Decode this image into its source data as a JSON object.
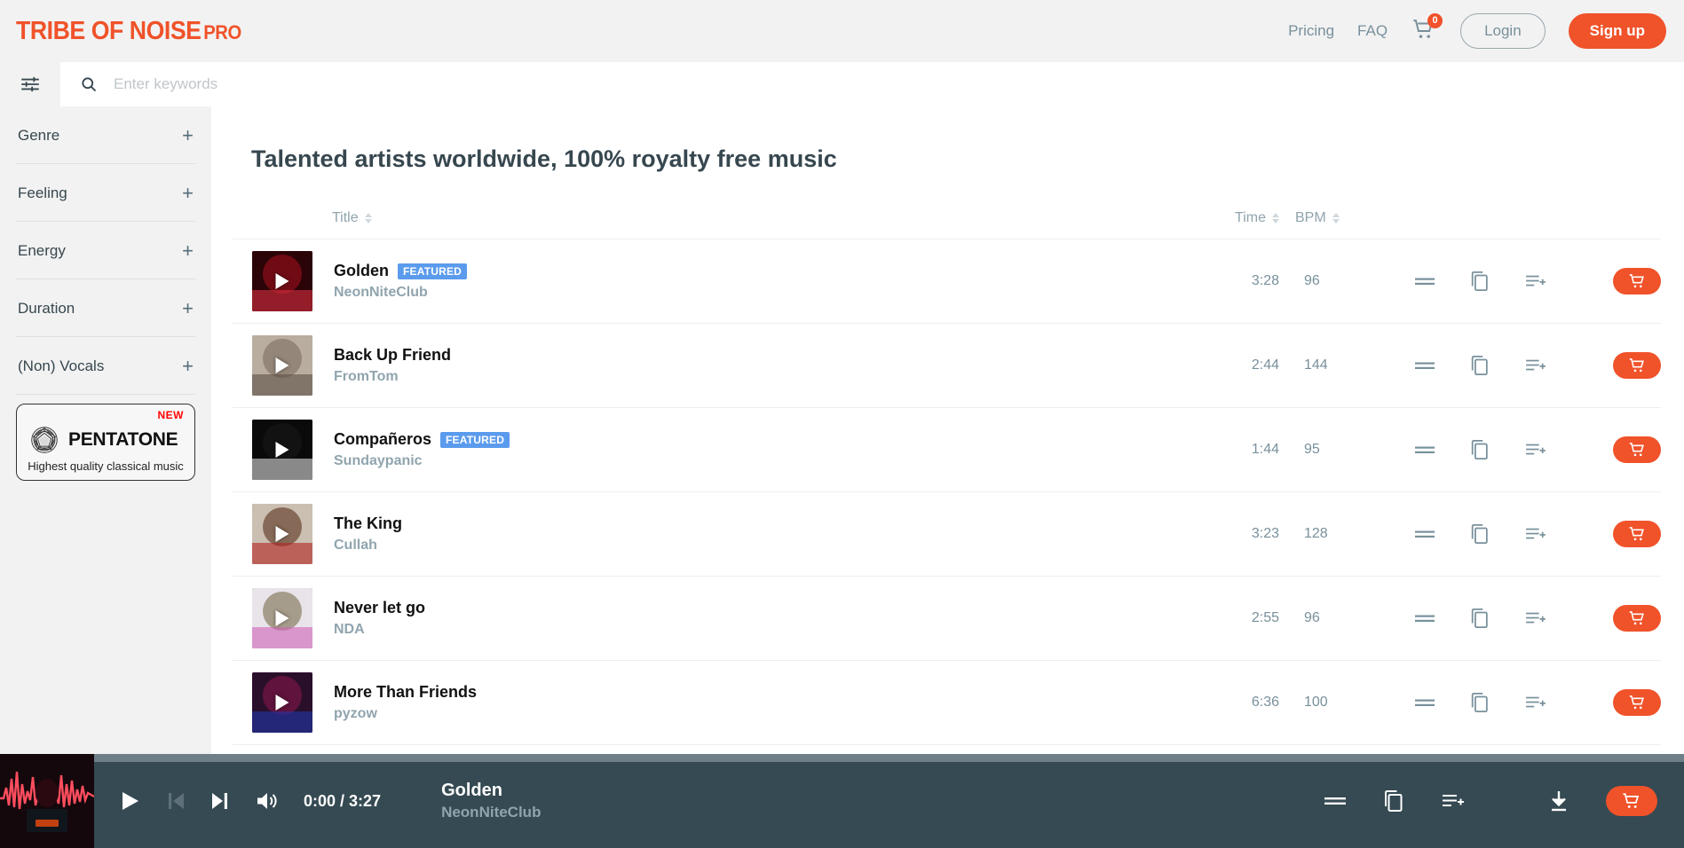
{
  "header": {
    "logo_main": "TRIBE OF NOISE",
    "logo_pro": "PRO",
    "nav": [
      {
        "label": "Pricing"
      },
      {
        "label": "FAQ"
      }
    ],
    "cart_count": "0",
    "login_label": "Login",
    "signup_label": "Sign up",
    "accent_color": "#f0522a"
  },
  "search": {
    "placeholder": "Enter keywords",
    "value": ""
  },
  "sidebar": {
    "filters": [
      {
        "label": "Genre",
        "expander": "+"
      },
      {
        "label": "Feeling",
        "expander": "+"
      },
      {
        "label": "Energy",
        "expander": "+"
      },
      {
        "label": "Duration",
        "expander": "+"
      },
      {
        "label": "(Non) Vocals",
        "expander": "+"
      }
    ],
    "promo": {
      "new_label": "NEW",
      "brand": "PENTATONE",
      "tagline": "Highest quality classical music"
    }
  },
  "main": {
    "page_title": "Talented artists worldwide, 100% royalty free music",
    "columns": {
      "title": "Title",
      "time": "Time",
      "bpm": "BPM"
    },
    "tracks": [
      {
        "title": "Golden",
        "artist": "NeonNiteClub",
        "badge": "FEATURED",
        "time": "3:28",
        "bpm": "96",
        "thumb_colors": [
          "#2b0408",
          "#7d0d16",
          "#d9303f"
        ]
      },
      {
        "title": "Back Up Friend",
        "artist": "FromTom",
        "badge": "",
        "time": "2:44",
        "bpm": "144",
        "thumb_colors": [
          "#b9ada0",
          "#8d7f72",
          "#5c4f45"
        ]
      },
      {
        "title": "Compañeros",
        "artist": "Sundaypanic",
        "badge": "FEATURED",
        "time": "1:44",
        "bpm": "95",
        "thumb_colors": [
          "#0a0a0a",
          "#141414",
          "#dddddd"
        ]
      },
      {
        "title": "The King",
        "artist": "Cullah",
        "badge": "",
        "time": "3:23",
        "bpm": "128",
        "thumb_colors": [
          "#cbbfb2",
          "#7a5a46",
          "#b3231f"
        ]
      },
      {
        "title": "Never let go",
        "artist": "NDA",
        "badge": "",
        "time": "2:55",
        "bpm": "96",
        "thumb_colors": [
          "#e8e4ea",
          "#9a8f7a",
          "#cf63b8"
        ]
      },
      {
        "title": "More Than Friends",
        "artist": "pyzow",
        "badge": "",
        "time": "6:36",
        "bpm": "100",
        "thumb_colors": [
          "#2a0f2b",
          "#6a1440",
          "#2136a8"
        ]
      }
    ]
  },
  "player": {
    "now_playing_title": "Golden",
    "now_playing_artist": "NeonNiteClub",
    "time_display": "0:00 / 3:27",
    "progress_percent": 0
  }
}
